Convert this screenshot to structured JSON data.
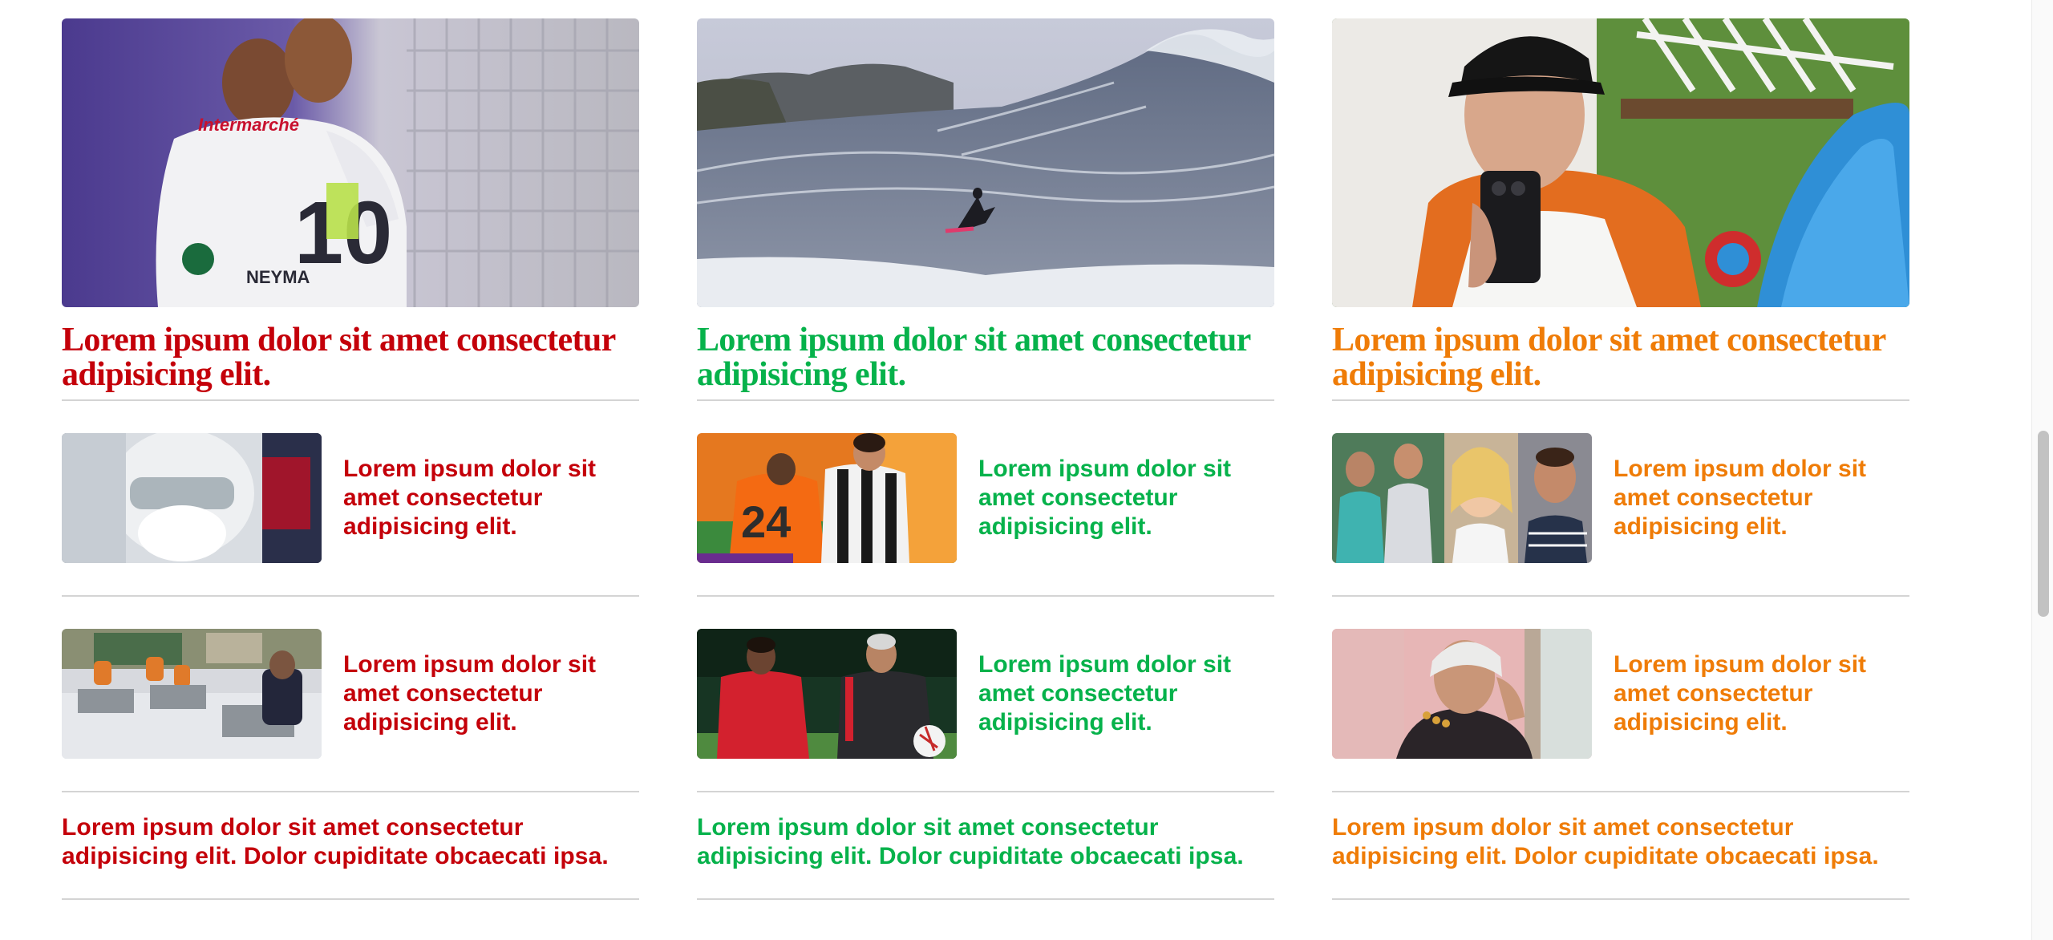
{
  "colors": {
    "red": "#c4000a",
    "green": "#06b24b",
    "orange": "#ef7c07",
    "divider": "#d4d4d4"
  },
  "columns": [
    {
      "accent": "red",
      "hero": {
        "image": "soccer-players-embracing-photo",
        "title": "Lorem ipsum dolor sit amet consectetur adipisicing elit."
      },
      "stories": [
        {
          "image": "health-worker-protective-mask-photo",
          "title": "Lorem ipsum dolor sit amet consectetur adipisicing elit."
        },
        {
          "image": "classroom-students-masks-photo",
          "title": "Lorem ipsum dolor sit amet consectetur adipisicing elit."
        }
      ],
      "text_story": "Lorem ipsum dolor sit amet consectetur adipisicing elit. Dolor cupiditate obcaecati ipsa."
    },
    {
      "accent": "green",
      "hero": {
        "image": "big-wave-surfer-photo",
        "title": "Lorem ipsum dolor sit amet consectetur adipisicing elit."
      },
      "stories": [
        {
          "image": "soccer-match-players-photo",
          "title": "Lorem ipsum dolor sit amet consectetur adipisicing elit."
        },
        {
          "image": "soccer-players-training-photo",
          "title": "Lorem ipsum dolor sit amet consectetur adipisicing elit."
        }
      ],
      "text_story": "Lorem ipsum dolor sit amet consectetur adipisicing elit. Dolor cupiditate obcaecati ipsa."
    },
    {
      "accent": "orange",
      "hero": {
        "image": "man-selfie-surfboard-photo",
        "title": "Lorem ipsum dolor sit amet consectetur adipisicing elit."
      },
      "stories": [
        {
          "image": "celebrities-collage-photo",
          "title": "Lorem ipsum dolor sit amet consectetur adipisicing elit."
        },
        {
          "image": "elderly-woman-smiling-photo",
          "title": "Lorem ipsum dolor sit amet consectetur adipisicing elit."
        }
      ],
      "text_story": "Lorem ipsum dolor sit amet consectetur adipisicing elit. Dolor cupiditate obcaecati ipsa."
    }
  ]
}
